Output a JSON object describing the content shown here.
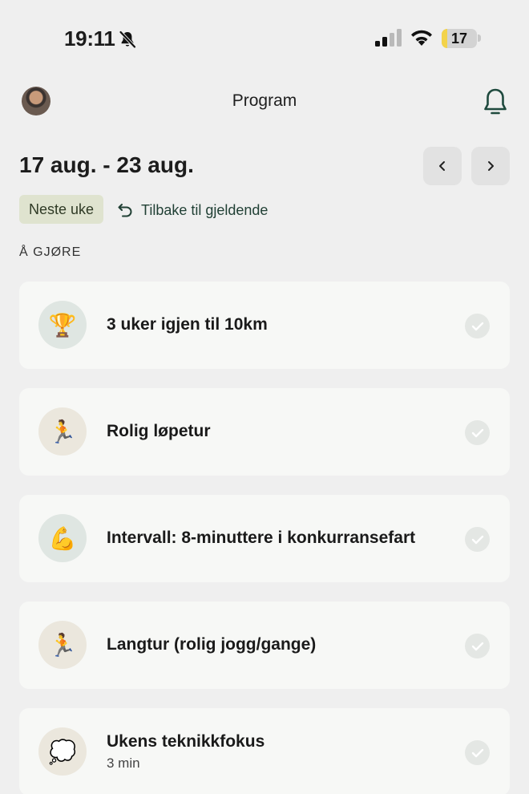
{
  "status_bar": {
    "time": "19:11",
    "battery_level": "17",
    "battery_fraction": 0.17,
    "icons": [
      "bell-slash-icon",
      "cellular-signal-icon",
      "wifi-icon",
      "battery-icon"
    ]
  },
  "header": {
    "title": "Program",
    "avatar": "user-avatar",
    "notification_icon": "bell-icon"
  },
  "week": {
    "range": "17 aug. - 23 aug.",
    "prev_icon": "chevron-left-icon",
    "next_icon": "chevron-right-icon",
    "badge": "Neste uke",
    "back_label": "Tilbake til gjeldende"
  },
  "section": {
    "label": "Å GJØRE"
  },
  "tasks": [
    {
      "title": "3 uker igjen til 10km",
      "subtitle": "",
      "icon": "trophy-icon",
      "emoji": "🏆",
      "color": "#dfe6e2",
      "done": false
    },
    {
      "title": "Rolig løpetur",
      "subtitle": "",
      "icon": "runner-icon",
      "emoji": "🏃",
      "color": "#ebe7dd",
      "done": false
    },
    {
      "title": "Intervall: 8-minuttere i konkurransefart",
      "subtitle": "",
      "icon": "flexed-biceps-icon",
      "emoji": "💪",
      "color": "#dfe6e2",
      "done": false
    },
    {
      "title": "Langtur (rolig jogg/gange)",
      "subtitle": "",
      "icon": "runner-icon",
      "emoji": "🏃",
      "color": "#ebe7dd",
      "done": false
    },
    {
      "title": "Ukens teknikkfokus",
      "subtitle": "3 min",
      "icon": "thought-balloon-icon",
      "emoji": "💭",
      "color": "#ebe7dd",
      "done": false
    }
  ]
}
